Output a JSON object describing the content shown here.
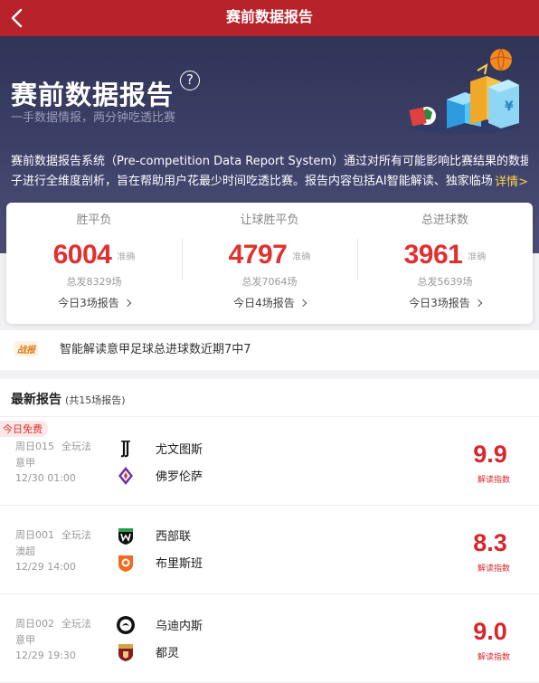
{
  "nav": {
    "title": "赛前数据报告"
  },
  "hero": {
    "title": "赛前数据报告",
    "help_glyph": "?",
    "subtitle": "一手数据情报，两分钟吃透比赛",
    "desc_line1": "赛前数据报告系统（Pre-competition Data Report System）通过对所有可能影响比赛结果的数据因",
    "desc_line2": "子进行全维度剖析，旨在帮助用户花最少时间吃透比赛。报告内容包括AI智能解读、独家临场",
    "more": "详情>"
  },
  "stats": [
    {
      "label": "胜平负",
      "value": "6004",
      "tag": "准确",
      "total": "总发8329场",
      "today": "今日3场报告"
    },
    {
      "label": "让球胜平负",
      "value": "4797",
      "tag": "准确",
      "total": "总发7064场",
      "today": "今日4场报告"
    },
    {
      "label": "总进球数",
      "value": "3961",
      "tag": "准确",
      "total": "总发5639场",
      "today": "今日3场报告"
    }
  ],
  "news": {
    "tag": "战报",
    "text": "智能解读意甲足球总进球数近期7中7"
  },
  "list": {
    "title": "最新报告",
    "count": "(共15场报告)"
  },
  "matches": [
    {
      "badge": "今日免费",
      "code": "周日015",
      "play": "全玩法",
      "league": "意甲",
      "time": "12/30 01:00",
      "home": "尤文图斯",
      "away": "佛罗伦萨",
      "home_icon": "juventus-logo",
      "away_icon": "fiorentina-logo",
      "index": "9.9",
      "index_label": "解读指数"
    },
    {
      "badge": "",
      "code": "周日001",
      "play": "全玩法",
      "league": "澳超",
      "time": "12/29 14:00",
      "home": "西部联",
      "away": "布里斯班",
      "home_icon": "western-united-logo",
      "away_icon": "brisbane-logo",
      "index": "8.3",
      "index_label": "解读指数"
    },
    {
      "badge": "",
      "code": "周日002",
      "play": "全玩法",
      "league": "意甲",
      "time": "12/29 19:30",
      "home": "乌迪内斯",
      "away": "都灵",
      "home_icon": "udinese-logo",
      "away_icon": "torino-logo",
      "index": "9.0",
      "index_label": "解读指数"
    }
  ],
  "colors": {
    "nav_bg": "#b8232b",
    "accent_red": "#e0312f",
    "hero_bg": "#3c4067",
    "more_yellow": "#ffd34a"
  }
}
